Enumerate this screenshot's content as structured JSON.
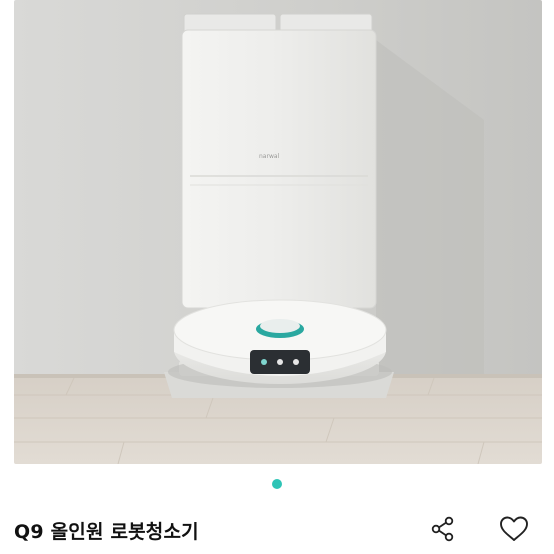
{
  "listing": {
    "title": "Q9 올인원 로봇청소기",
    "image_count": 1,
    "active_image_index": 0
  },
  "image": {
    "subject": "robot vacuum with self-emptying dock",
    "dock_brand_text": "narwal"
  },
  "actions": {
    "share_icon": "share-icon",
    "like_icon": "heart-outline-icon"
  },
  "colors": {
    "accent": "#2ec4b6",
    "title": "#111111",
    "icon": "#222222"
  }
}
